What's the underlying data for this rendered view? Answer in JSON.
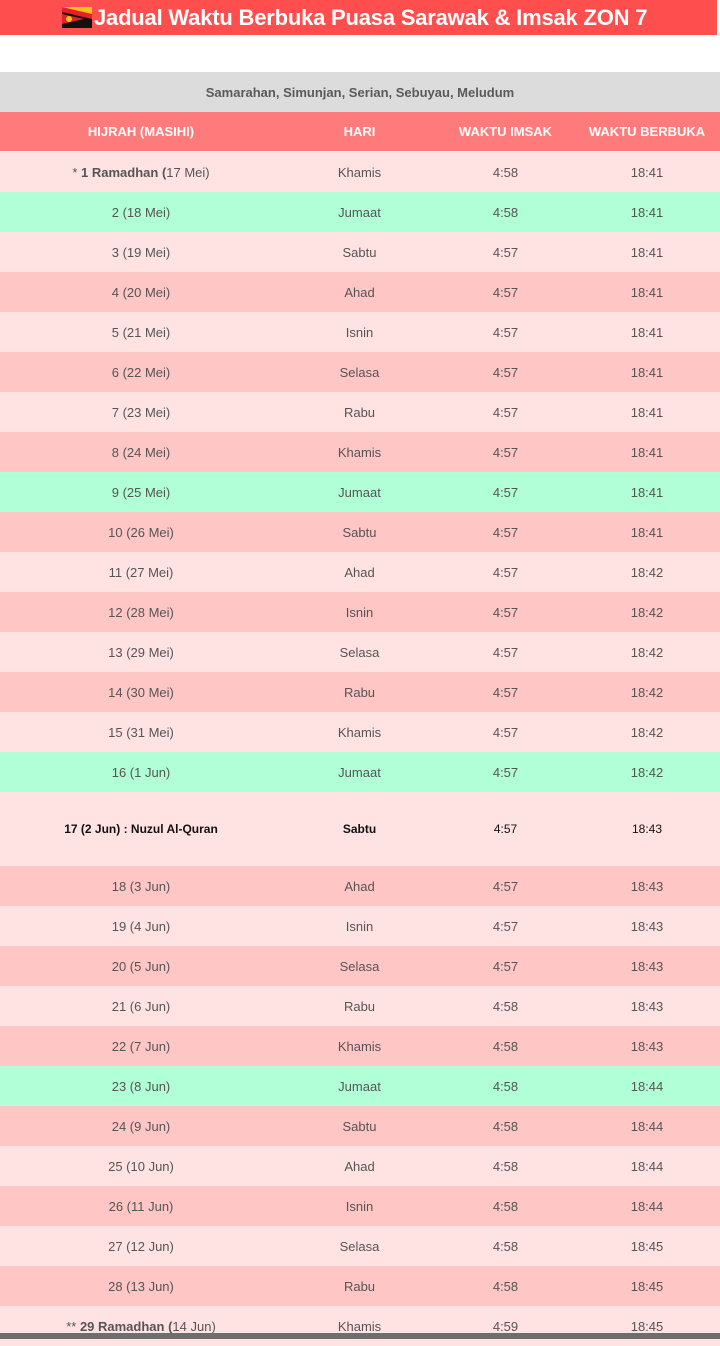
{
  "title": "Jadual Waktu Berbuka Puasa Sarawak & Imsak ZON 7",
  "zone_areas": "Samarahan, Simunjan, Serian, Sebuyau, Meludum",
  "headers": [
    "HIJRAH (MASIHI)",
    "HARI",
    "WAKTU IMSAK",
    "WAKTU BERBUKA"
  ],
  "colors": {
    "title_bg": "#fe4e4e",
    "header_bg": "#ff7b7b",
    "row_light": "#ffe3e3",
    "row_pink": "#ffc6c6",
    "row_friday": "#b1ffd6"
  },
  "rows": [
    {
      "prefix": "* ",
      "bold": "1 Ramadhan (",
      "rest": "17 Mei)",
      "day": "Khamis",
      "imsak": "4:58",
      "berbuka": "18:41",
      "tone": "light"
    },
    {
      "text": "2 (18 Mei)",
      "day": "Jumaat",
      "imsak": "4:58",
      "berbuka": "18:41",
      "tone": "green"
    },
    {
      "text": "3 (19 Mei)",
      "day": "Sabtu",
      "imsak": "4:57",
      "berbuka": "18:41",
      "tone": "light"
    },
    {
      "text": "4 (20 Mei)",
      "day": "Ahad",
      "imsak": "4:57",
      "berbuka": "18:41",
      "tone": "pink"
    },
    {
      "text": "5 (21 Mei)",
      "day": "Isnin",
      "imsak": "4:57",
      "berbuka": "18:41",
      "tone": "light"
    },
    {
      "text": "6 (22 Mei)",
      "day": "Selasa",
      "imsak": "4:57",
      "berbuka": "18:41",
      "tone": "pink"
    },
    {
      "text": "7 (23 Mei)",
      "day": "Rabu",
      "imsak": "4:57",
      "berbuka": "18:41",
      "tone": "light"
    },
    {
      "text": "8 (24 Mei)",
      "day": "Khamis",
      "imsak": "4:57",
      "berbuka": "18:41",
      "tone": "pink"
    },
    {
      "text": "9 (25 Mei)",
      "day": "Jumaat",
      "imsak": "4:57",
      "berbuka": "18:41",
      "tone": "green"
    },
    {
      "text": "10 (26 Mei)",
      "day": "Sabtu",
      "imsak": "4:57",
      "berbuka": "18:41",
      "tone": "pink"
    },
    {
      "text": "11 (27 Mei)",
      "day": "Ahad",
      "imsak": "4:57",
      "berbuka": "18:42",
      "tone": "light"
    },
    {
      "text": "12 (28 Mei)",
      "day": "Isnin",
      "imsak": "4:57",
      "berbuka": "18:42",
      "tone": "pink"
    },
    {
      "text": "13 (29 Mei)",
      "day": "Selasa",
      "imsak": "4:57",
      "berbuka": "18:42",
      "tone": "light"
    },
    {
      "text": "14 (30 Mei)",
      "day": "Rabu",
      "imsak": "4:57",
      "berbuka": "18:42",
      "tone": "pink"
    },
    {
      "text": "15 (31 Mei)",
      "day": "Khamis",
      "imsak": "4:57",
      "berbuka": "18:42",
      "tone": "light"
    },
    {
      "text": "16 (1 Jun)",
      "day": "Jumaat",
      "imsak": "4:57",
      "berbuka": "18:42",
      "tone": "green"
    },
    {
      "text": "17 (2 Jun) : Nuzul Al-Quran",
      "day": "Sabtu",
      "imsak": "4:57",
      "berbuka": "18:43",
      "tone": "light",
      "special": true
    },
    {
      "text": "18 (3 Jun)",
      "day": "Ahad",
      "imsak": "4:57",
      "berbuka": "18:43",
      "tone": "pink"
    },
    {
      "text": "19 (4 Jun)",
      "day": "Isnin",
      "imsak": "4:57",
      "berbuka": "18:43",
      "tone": "light"
    },
    {
      "text": "20 (5 Jun)",
      "day": "Selasa",
      "imsak": "4:57",
      "berbuka": "18:43",
      "tone": "pink"
    },
    {
      "text": "21 (6 Jun)",
      "day": "Rabu",
      "imsak": "4:58",
      "berbuka": "18:43",
      "tone": "light"
    },
    {
      "text": "22 (7 Jun)",
      "day": "Khamis",
      "imsak": "4:58",
      "berbuka": "18:43",
      "tone": "pink"
    },
    {
      "text": "23 (8 Jun)",
      "day": "Jumaat",
      "imsak": "4:58",
      "berbuka": "18:44",
      "tone": "green"
    },
    {
      "text": "24 (9 Jun)",
      "day": "Sabtu",
      "imsak": "4:58",
      "berbuka": "18:44",
      "tone": "pink"
    },
    {
      "text": "25 (10 Jun)",
      "day": "Ahad",
      "imsak": "4:58",
      "berbuka": "18:44",
      "tone": "light"
    },
    {
      "text": "26 (11 Jun)",
      "day": "Isnin",
      "imsak": "4:58",
      "berbuka": "18:44",
      "tone": "pink"
    },
    {
      "text": "27 (12 Jun)",
      "day": "Selasa",
      "imsak": "4:58",
      "berbuka": "18:45",
      "tone": "light"
    },
    {
      "text": "28 (13 Jun)",
      "day": "Rabu",
      "imsak": "4:58",
      "berbuka": "18:45",
      "tone": "pink"
    },
    {
      "prefix": "** ",
      "bold": "29 Ramadhan (",
      "rest": "14 Jun)",
      "day": "Khamis",
      "imsak": "4:59",
      "berbuka": "18:45",
      "tone": "light"
    }
  ]
}
